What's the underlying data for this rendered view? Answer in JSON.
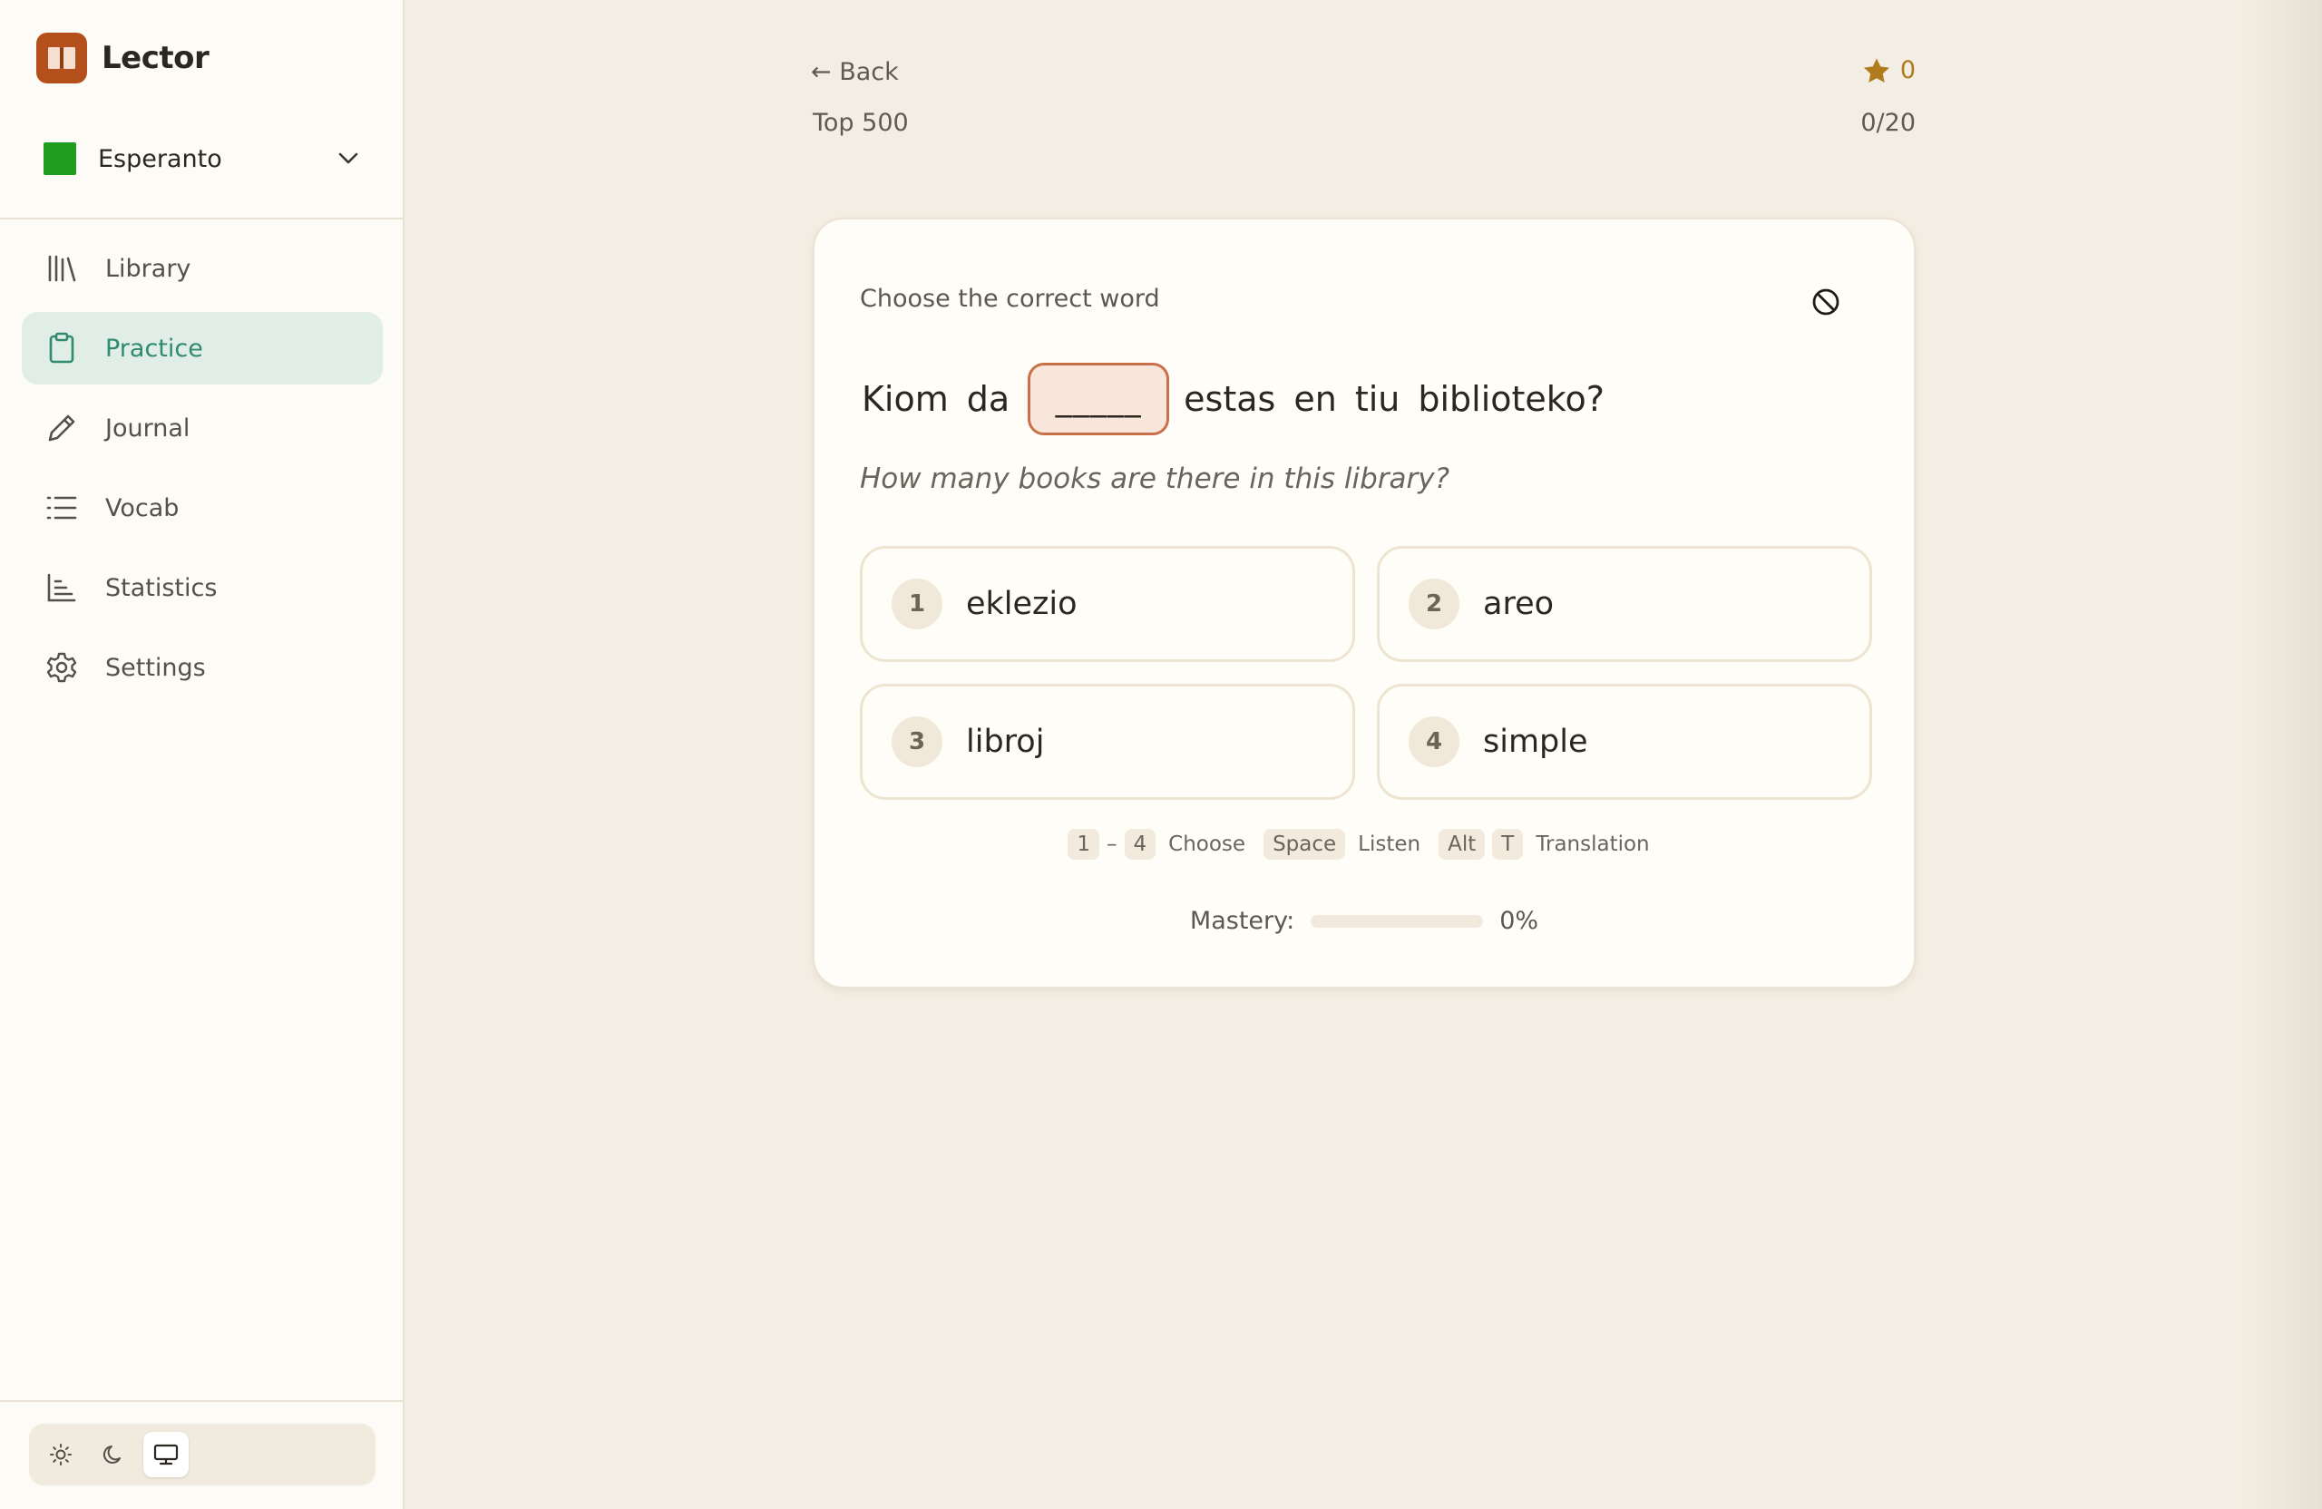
{
  "app": {
    "name": "Lector"
  },
  "language": {
    "selected": "Esperanto",
    "flag_color": "#1f9d1f"
  },
  "nav": {
    "items": [
      {
        "label": "Library",
        "icon": "library-icon",
        "active": false
      },
      {
        "label": "Practice",
        "icon": "clipboard-icon",
        "active": true
      },
      {
        "label": "Journal",
        "icon": "pencil-icon",
        "active": false
      },
      {
        "label": "Vocab",
        "icon": "list-icon",
        "active": false
      },
      {
        "label": "Statistics",
        "icon": "bar-chart-icon",
        "active": false
      },
      {
        "label": "Settings",
        "icon": "gear-icon",
        "active": false
      }
    ]
  },
  "theme": {
    "options": [
      "light",
      "dark",
      "system"
    ],
    "selected": "system"
  },
  "header": {
    "back_label": "← Back",
    "deck_name": "Top 500",
    "stars": "0",
    "progress": "0/20"
  },
  "exercise": {
    "instruction": "Choose the correct word",
    "sentence_before": [
      "Kiom",
      "da"
    ],
    "blank": "_____",
    "sentence_after": [
      "estas",
      "en",
      "tiu",
      "biblioteko?"
    ],
    "translation": "How many books are there in this library?",
    "options": [
      {
        "num": "1",
        "word": "eklezio"
      },
      {
        "num": "2",
        "word": "areo"
      },
      {
        "num": "3",
        "word": "libroj"
      },
      {
        "num": "4",
        "word": "simple"
      }
    ]
  },
  "shortcuts": {
    "range_start": "1",
    "range_dash": "–",
    "range_end": "4",
    "choose": "Choose",
    "space_key": "Space",
    "listen": "Listen",
    "alt_key": "Alt",
    "t_key": "T",
    "translation": "Translation"
  },
  "mastery": {
    "label": "Mastery:",
    "value_text": "0%",
    "fraction": 0
  },
  "colors": {
    "accent": "#2f8a6e",
    "brand": "#b4501c",
    "blank_border": "#c9704a",
    "star": "#b07a1d"
  }
}
